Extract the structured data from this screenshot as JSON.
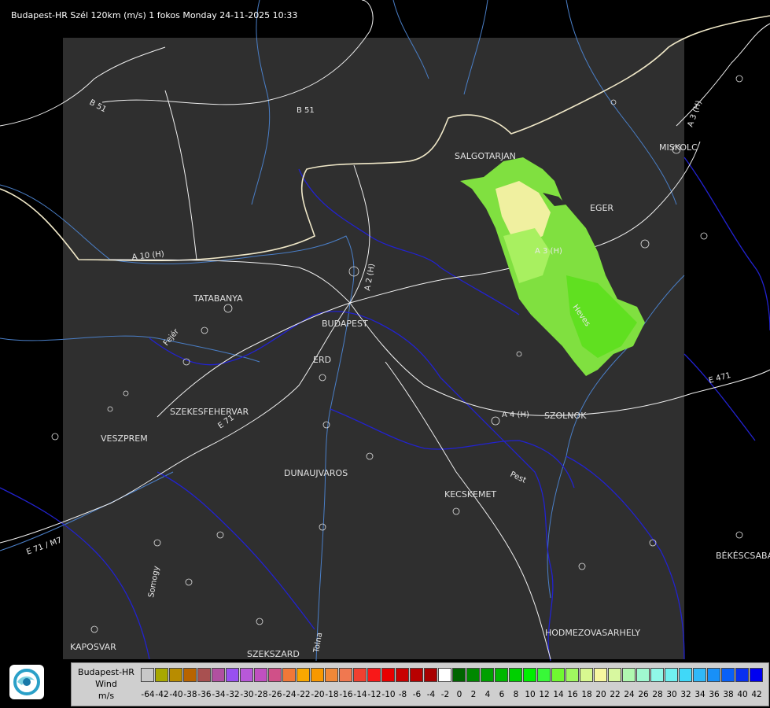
{
  "title": "Budapest-HR Szél 120km (m/s) 1 fokos Monday 24-11-2025 10:33",
  "cities": [
    {
      "id": "salgotarjan",
      "name": "SALGOTARJAN"
    },
    {
      "id": "miskolc",
      "name": "MISKOLC"
    },
    {
      "id": "eger",
      "name": "EGER"
    },
    {
      "id": "tatabanya",
      "name": "TATABANYA"
    },
    {
      "id": "budapest",
      "name": "BUDAPEST"
    },
    {
      "id": "erd",
      "name": "ERD"
    },
    {
      "id": "szekesfehervar",
      "name": "SZEKESFEHERVAR"
    },
    {
      "id": "veszprem",
      "name": "VESZPREM"
    },
    {
      "id": "szolnok",
      "name": "SZOLNOK"
    },
    {
      "id": "dunaujvaros",
      "name": "DUNAUJVAROS"
    },
    {
      "id": "kecskemet",
      "name": "KECSKEMET"
    },
    {
      "id": "bekescsaba",
      "name": "BÉKÉSCSABA"
    },
    {
      "id": "hodmezovasarhely",
      "name": "HODMEZOVASARHELY"
    },
    {
      "id": "kaposvar",
      "name": "KAPOSVAR"
    },
    {
      "id": "szekszard",
      "name": "SZEKSZARD"
    }
  ],
  "roads": [
    {
      "id": "b51a",
      "label": "B 51"
    },
    {
      "id": "b51b",
      "label": "B 51"
    },
    {
      "id": "a10",
      "label": "A 10 (H)"
    },
    {
      "id": "a2",
      "label": "A 2 (H)"
    },
    {
      "id": "a3",
      "label": "A 3 (H)"
    },
    {
      "id": "a3ne",
      "label": "A 3 (H)"
    },
    {
      "id": "a4",
      "label": "A 4 (H)"
    },
    {
      "id": "e71",
      "label": "E 71"
    },
    {
      "id": "e71sw",
      "label": "E 71 / M7"
    },
    {
      "id": "e471",
      "label": "E 471"
    }
  ],
  "regions": [
    {
      "id": "pest",
      "label": "Pest"
    },
    {
      "id": "heves",
      "label": "Heves"
    },
    {
      "id": "fejer",
      "label": "Fejér"
    },
    {
      "id": "somogy",
      "label": "Somogy"
    },
    {
      "id": "tolna",
      "label": "Tolna"
    }
  ],
  "legend": {
    "label_line1": "Budapest-HR",
    "label_line2": "Wind",
    "label_line3": "m/s",
    "colors": [
      "#c8c8c8",
      "#a8a800",
      "#b88c00",
      "#b86400",
      "#a85050",
      "#b050a0",
      "#9850f0",
      "#b858d8",
      "#c050c0",
      "#d05088",
      "#f07838",
      "#f8a800",
      "#f89800",
      "#f08838",
      "#f07850",
      "#f04030",
      "#f81818",
      "#e80000",
      "#c80000",
      "#b80000",
      "#a80000",
      "#ffffff",
      "#006400",
      "#008800",
      "#00a000",
      "#00b800",
      "#00d000",
      "#00f000",
      "#38f838",
      "#70f830",
      "#a0f860",
      "#d8f890",
      "#f8f8a0",
      "#d8f8a0",
      "#b0f8b0",
      "#a0f8d0",
      "#90f8e8",
      "#70f0f0",
      "#40d8f8",
      "#30b8f8",
      "#1890f8",
      "#0860f8",
      "#0830f0",
      "#0000f0"
    ],
    "ticks": [
      "-64",
      "-42",
      "-40",
      "-38",
      "-36",
      "-34",
      "-32",
      "-30",
      "-28",
      "-26",
      "-24",
      "-22",
      "-20",
      "-18",
      "-16",
      "-14",
      "-12",
      "-10",
      "-8",
      "-6",
      "-4",
      "-2",
      "0",
      "2",
      "4",
      "6",
      "8",
      "10",
      "12",
      "14",
      "16",
      "18",
      "20",
      "22",
      "24",
      "26",
      "28",
      "30",
      "32",
      "34",
      "36",
      "38",
      "40",
      "42"
    ]
  },
  "icons": [
    "radar-logo-icon"
  ],
  "colors": {
    "background": "#000000",
    "radar_area": "#2f2f2f",
    "border": "#ffffff",
    "river": "#4a7fc8",
    "county": "#2020c8",
    "echo_light": "#a8f060",
    "echo_mid": "#80e040",
    "echo_strong": "#60e020",
    "echo_yellow": "#f0f0a0"
  }
}
